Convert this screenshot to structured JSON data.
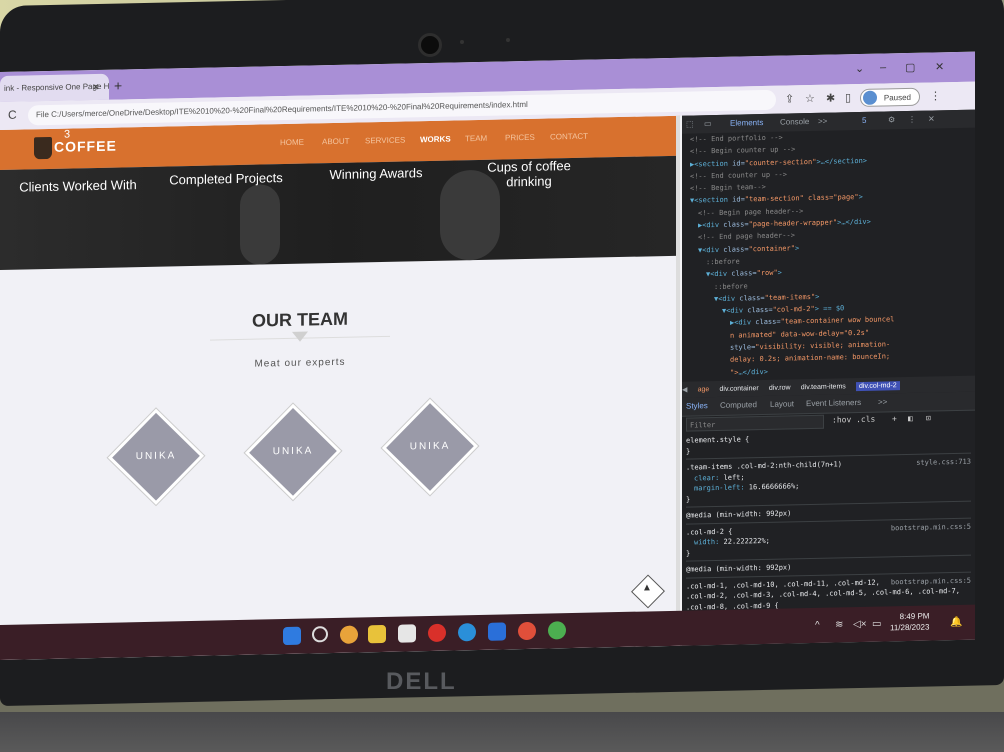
{
  "browser": {
    "tab_title": "ink - Responsive One Page H",
    "tab_close": "✕",
    "new_tab": "+",
    "reload_icon": "C",
    "url": "File  C:/Users/merce/OneDrive/Desktop/ITE%2010%20-%20Final%20Requirements/ITE%2010%20-%20Final%20Requirements/index.html",
    "paused_label": "Paused",
    "min_icon": "⌄",
    "minimize": "–",
    "restore": "▢",
    "close": "✕"
  },
  "site": {
    "logo_text": "COFFEE",
    "logo_number": "3",
    "nav": [
      "HOME",
      "ABOUT",
      "SERVICES",
      "WORKS",
      "TEAM",
      "PRICES",
      "CONTACT"
    ],
    "active_nav": "WORKS",
    "counters": [
      "Clients Worked With",
      "Completed Projects",
      "Winning Awards",
      "Cups of coffee drinking"
    ],
    "team_title": "OUR TEAM",
    "team_subtitle": "Meat our experts",
    "members": [
      "UNIKA",
      "UNIKA",
      "UNIKA"
    ],
    "scroll_top_icon": "➜"
  },
  "devtools": {
    "tabs": [
      "Elements",
      "Console",
      ">>"
    ],
    "issues_count": "5",
    "elements": [
      {
        "indent": 1,
        "comment": "<!-- End portfolio -->"
      },
      {
        "indent": 1,
        "comment": "<!-- Begin counter up -->"
      },
      {
        "indent": 1,
        "tag": "▶<section",
        "attr": " id=",
        "val": "\"counter-section\"",
        "end": ">…</section>"
      },
      {
        "indent": 1,
        "comment": "<!-- End counter up -->"
      },
      {
        "indent": 1,
        "comment": "<!-- Begin team-->"
      },
      {
        "indent": 1,
        "tag": "▼<section",
        "attr": " id=",
        "val": "\"team-section\" class=\"page\"",
        "end": ">"
      },
      {
        "indent": 2,
        "comment": "<!-- Begin page header-->"
      },
      {
        "indent": 2,
        "tag": "▶<div",
        "attr": " class=",
        "val": "\"page-header-wrapper\"",
        "end": ">…</div>"
      },
      {
        "indent": 2,
        "comment": "<!-- End page header-->"
      },
      {
        "indent": 2,
        "tag": "▼<div",
        "attr": " class=",
        "val": "\"container\"",
        "end": ">"
      },
      {
        "indent": 3,
        "comment": "::before"
      },
      {
        "indent": 3,
        "tag": "▼<div",
        "attr": " class=",
        "val": "\"row\"",
        "end": ">"
      },
      {
        "indent": 4,
        "comment": "::before"
      },
      {
        "indent": 4,
        "tag": "▼<div",
        "attr": " class=",
        "val": "\"team-items\"",
        "end": ">"
      },
      {
        "indent": 5,
        "tag": "▼<div",
        "attr": " class=",
        "val": "\"col-md-2\"",
        "end": "> == $0"
      },
      {
        "indent": 6,
        "tag": "▶<div",
        "attr": " class=",
        "val": "\"team-container wow bouncel",
        "end": ""
      },
      {
        "indent": 6,
        "tag": "",
        "attr": "",
        "val": "n animated\" data-wow-delay=\"0.2s\"",
        "end": ""
      },
      {
        "indent": 6,
        "tag": "",
        "attr": "style=",
        "val": "\"visibility: visible; animation-",
        "end": ""
      },
      {
        "indent": 6,
        "tag": "",
        "attr": "",
        "val": "delay: 0.2s; animation-name: bounceIn;",
        "end": ""
      },
      {
        "indent": 6,
        "tag": "",
        "attr": "",
        "val": "\">",
        "end": "…</div>"
      },
      {
        "indent": 5,
        "tag": "</div>",
        "attr": "",
        "val": "",
        "end": ""
      },
      {
        "indent": 5,
        "tag": "▶<div",
        "attr": " class=",
        "val": "\"col-md-2\"",
        "end": ">…</div>"
      }
    ],
    "breadcrumb": [
      "age",
      "div.container",
      "div.row",
      "div.team-items",
      "div.col-md-2"
    ],
    "style_tabs": [
      "Styles",
      "Computed",
      "Layout",
      "Event Listeners",
      ">>"
    ],
    "filter_placeholder": "Filter",
    "filter_tools": ":hov .cls",
    "rules": [
      {
        "selector": "element.style {",
        "source": "",
        "props": [],
        "close": "}"
      },
      {
        "selector": ".team-items .col-md-2:nth-child(7n+1)",
        "source": "style.css:713",
        "props": [
          [
            "clear",
            "left;"
          ],
          [
            "margin-left",
            "16.6666666%;"
          ]
        ],
        "close": "}"
      },
      {
        "selector": "@media (min-width: 992px)",
        "source": "",
        "props": [],
        "close": ""
      },
      {
        "selector": ".col-md-2 {",
        "source": "bootstrap.min.css:5",
        "props": [
          [
            "width",
            "22.222222%;"
          ]
        ],
        "close": "}"
      },
      {
        "selector": "@media (min-width: 992px)",
        "source": "",
        "props": [],
        "close": ""
      },
      {
        "selector": ".col-md-1, .col-md-10, .col-md-11, .col-md-12, .col-md-2, .col-md-3, .col-md-4, .col-md-5, .col-md-6, .col-md-7, .col-md-8, .col-md-9 {",
        "source": "bootstrap.min.css:5",
        "props": [
          [
            "float",
            "left;"
          ]
        ],
        "close": ""
      }
    ]
  },
  "taskbar": {
    "time": "8:49 PM",
    "date": "11/28/2023"
  },
  "hardware": {
    "brand": "DELL"
  },
  "colors": {
    "navbar": "#d8712e",
    "browser_tab_strip": "#a98fd6",
    "member_tile": "#9a9aa8",
    "devtools_bg": "#202124"
  }
}
